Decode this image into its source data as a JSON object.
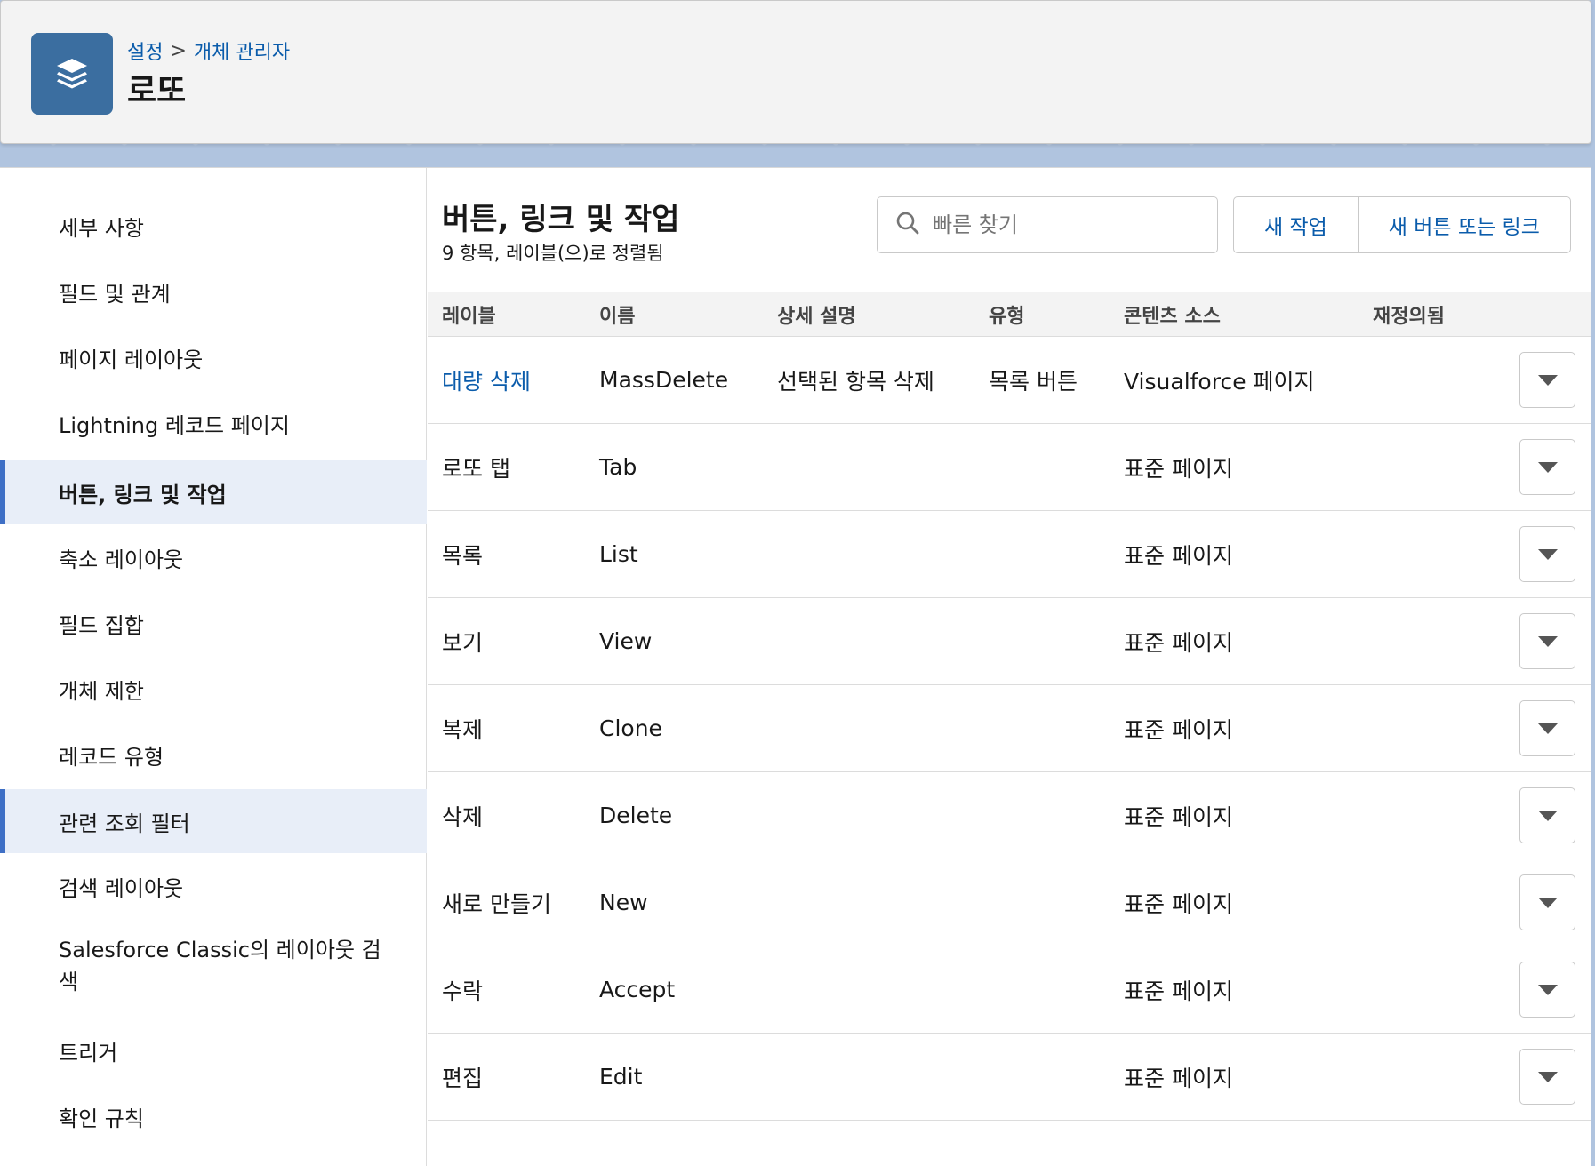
{
  "header": {
    "breadcrumb": [
      "설정",
      "개체 관리자"
    ],
    "breadcrumb_sep": ">",
    "title": "로또",
    "icon": "layers-icon"
  },
  "sidebar": {
    "items": [
      {
        "label": "세부 사항",
        "state": "normal"
      },
      {
        "label": "필드 및 관계",
        "state": "normal"
      },
      {
        "label": "페이지 레이아웃",
        "state": "normal"
      },
      {
        "label": "Lightning 레코드 페이지",
        "state": "normal"
      },
      {
        "label": "버튼, 링크 및 작업",
        "state": "active"
      },
      {
        "label": "축소 레이아웃",
        "state": "normal"
      },
      {
        "label": "필드 집합",
        "state": "normal"
      },
      {
        "label": "개체 제한",
        "state": "normal"
      },
      {
        "label": "레코드 유형",
        "state": "normal"
      },
      {
        "label": "관련 조회 필터",
        "state": "highlight"
      },
      {
        "label": "검색 레이아웃",
        "state": "normal"
      },
      {
        "label": "Salesforce Classic의 레이아웃 검색",
        "state": "normal"
      },
      {
        "label": "트리거",
        "state": "normal"
      },
      {
        "label": "확인 규칙",
        "state": "normal"
      }
    ]
  },
  "content": {
    "title": "버튼, 링크 및 작업",
    "subtitle": "9 항목, 레이블(으)로 정렬됨",
    "search": {
      "placeholder": "빠른 찾기",
      "value": ""
    },
    "buttons": {
      "new_action": "새 작업",
      "new_button": "새 버튼 또는 링크"
    }
  },
  "table": {
    "columns": [
      "레이블",
      "이름",
      "상세 설명",
      "유형",
      "콘텐츠 소스",
      "재정의됨"
    ],
    "rows": [
      {
        "label": "대량 삭제",
        "name": "MassDelete",
        "description": "선택된 항목 삭제",
        "type": "목록 버튼",
        "source": "Visualforce 페이지",
        "overridden": "",
        "is_link": true
      },
      {
        "label": "로또 탭",
        "name": "Tab",
        "description": "",
        "type": "",
        "source": "표준 페이지",
        "overridden": "",
        "is_link": false
      },
      {
        "label": "목록",
        "name": "List",
        "description": "",
        "type": "",
        "source": "표준 페이지",
        "overridden": "",
        "is_link": false
      },
      {
        "label": "보기",
        "name": "View",
        "description": "",
        "type": "",
        "source": "표준 페이지",
        "overridden": "",
        "is_link": false
      },
      {
        "label": "복제",
        "name": "Clone",
        "description": "",
        "type": "",
        "source": "표준 페이지",
        "overridden": "",
        "is_link": false
      },
      {
        "label": "삭제",
        "name": "Delete",
        "description": "",
        "type": "",
        "source": "표준 페이지",
        "overridden": "",
        "is_link": false
      },
      {
        "label": "새로 만들기",
        "name": "New",
        "description": "",
        "type": "",
        "source": "표준 페이지",
        "overridden": "",
        "is_link": false
      },
      {
        "label": "수락",
        "name": "Accept",
        "description": "",
        "type": "",
        "source": "표준 페이지",
        "overridden": "",
        "is_link": false
      },
      {
        "label": "편집",
        "name": "Edit",
        "description": "",
        "type": "",
        "source": "표준 페이지",
        "overridden": "",
        "is_link": false
      }
    ]
  },
  "colors": {
    "link": "#0b5cab",
    "header_icon_bg": "#3b6ea0",
    "active_nav_bg": "#e8eef8",
    "active_nav_border": "#3e6fc5"
  }
}
